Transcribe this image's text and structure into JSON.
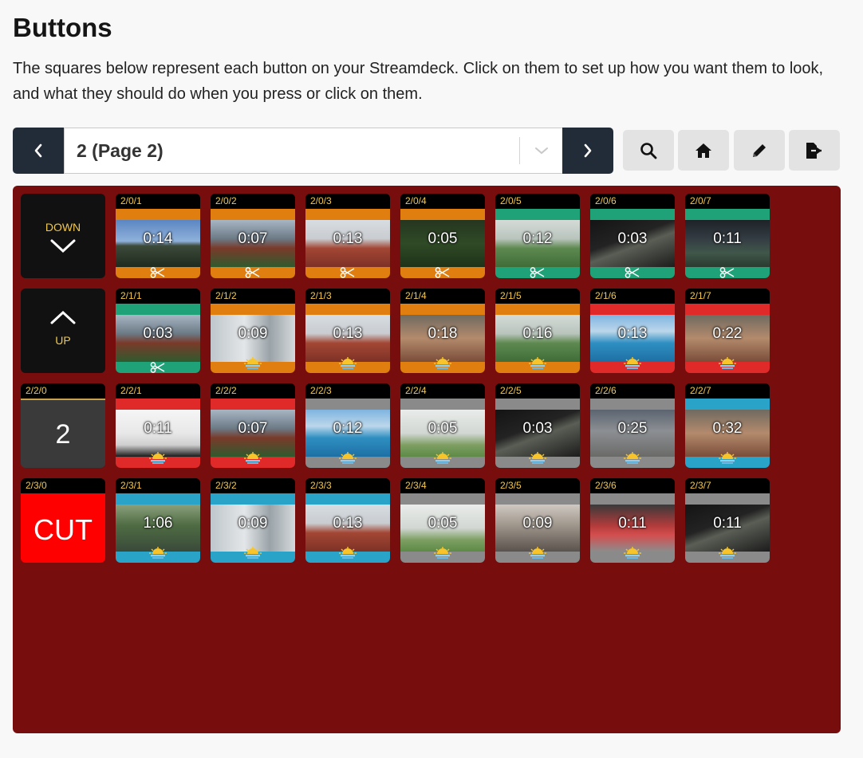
{
  "page": {
    "title": "Buttons",
    "intro": "The squares below represent each button on your Streamdeck. Click on them to set up how you want them to look, and what they should do when you press or click on them."
  },
  "toolbar": {
    "page_select": "2 (Page 2)",
    "prev_icon": "chevron-left-icon",
    "next_icon": "chevron-right-icon",
    "dropdown_icon": "chevron-down-icon",
    "tools": [
      "search-icon",
      "home-icon",
      "pencil-icon",
      "export-icon"
    ]
  },
  "colors": {
    "grid_bg": "#780d0d",
    "label_text": "#f2c94c",
    "nav_dark": "#222b38",
    "orange": "#e07f0f",
    "green": "#1fa277",
    "red": "#e02a2a",
    "gray": "#8a8a8a",
    "blue": "#2aa3c8"
  },
  "grid": {
    "rows": [
      [
        {
          "type": "nav",
          "text": "DOWN",
          "icon": "chevron-down-icon"
        },
        {
          "label": "2/0/1",
          "time": "0:14",
          "color": "orange",
          "icon": "scissors-icon",
          "scene": "city"
        },
        {
          "label": "2/0/2",
          "time": "0:07",
          "color": "orange",
          "icon": "scissors-icon",
          "scene": "stadium"
        },
        {
          "label": "2/0/3",
          "time": "0:13",
          "color": "orange",
          "icon": "scissors-icon",
          "scene": "court"
        },
        {
          "label": "2/0/4",
          "time": "0:05",
          "color": "orange",
          "icon": "scissors-icon",
          "scene": "dark"
        },
        {
          "label": "2/0/5",
          "time": "0:12",
          "color": "green",
          "icon": "scissors-icon",
          "scene": "field"
        },
        {
          "label": "2/0/6",
          "time": "0:03",
          "color": "green",
          "icon": "scissors-icon",
          "scene": "night"
        },
        {
          "label": "2/0/7",
          "time": "0:11",
          "color": "green",
          "icon": "scissors-icon",
          "scene": "pitch"
        }
      ],
      [
        {
          "type": "nav",
          "text": "UP",
          "icon": "chevron-up-icon"
        },
        {
          "label": "2/1/1",
          "time": "0:03",
          "color": "green",
          "icon": "scissors-icon",
          "scene": "stadium"
        },
        {
          "label": "2/1/2",
          "time": "0:09",
          "color": "orange",
          "icon": "sunrise-icon",
          "scene": "people"
        },
        {
          "label": "2/1/3",
          "time": "0:13",
          "color": "orange",
          "icon": "sunrise-icon",
          "scene": "court"
        },
        {
          "label": "2/1/4",
          "time": "0:18",
          "color": "orange",
          "icon": "sunrise-icon",
          "scene": "face"
        },
        {
          "label": "2/1/5",
          "time": "0:16",
          "color": "orange",
          "icon": "sunrise-icon",
          "scene": "field"
        },
        {
          "label": "2/1/6",
          "time": "0:13",
          "color": "red",
          "icon": "sunrise-icon",
          "scene": "pool"
        },
        {
          "label": "2/1/7",
          "time": "0:22",
          "color": "red",
          "icon": "sunrise-icon",
          "scene": "face"
        }
      ],
      [
        {
          "type": "page",
          "label": "2/2/0",
          "text": "2"
        },
        {
          "label": "2/2/1",
          "time": "0:11",
          "color": "red",
          "icon": "sunrise-icon",
          "scene": "hoop"
        },
        {
          "label": "2/2/2",
          "time": "0:07",
          "color": "red",
          "icon": "sunrise-icon",
          "scene": "stadium"
        },
        {
          "label": "2/2/3",
          "time": "0:12",
          "color": "gray",
          "icon": "sunrise-icon",
          "scene": "pool"
        },
        {
          "label": "2/2/4",
          "time": "0:05",
          "color": "gray",
          "icon": "sunrise-icon",
          "scene": "dome"
        },
        {
          "label": "2/2/5",
          "time": "0:03",
          "color": "gray",
          "icon": "sunrise-icon",
          "scene": "night"
        },
        {
          "label": "2/2/6",
          "time": "0:25",
          "color": "gray",
          "icon": "sunrise-icon",
          "scene": "hall"
        },
        {
          "label": "2/2/7",
          "time": "0:32",
          "color": "blue",
          "icon": "sunrise-icon",
          "scene": "face"
        }
      ],
      [
        {
          "type": "cut",
          "label": "2/3/0",
          "text": "CUT"
        },
        {
          "label": "2/3/1",
          "time": "1:06",
          "color": "blue",
          "icon": "sunrise-icon",
          "scene": "trees"
        },
        {
          "label": "2/3/2",
          "time": "0:09",
          "color": "blue",
          "icon": "sunrise-icon",
          "scene": "people"
        },
        {
          "label": "2/3/3",
          "time": "0:13",
          "color": "blue",
          "icon": "sunrise-icon",
          "scene": "court"
        },
        {
          "label": "2/3/4",
          "time": "0:05",
          "color": "gray",
          "icon": "sunrise-icon",
          "scene": "dome"
        },
        {
          "label": "2/3/5",
          "time": "0:09",
          "color": "gray",
          "icon": "sunrise-icon",
          "scene": "track"
        },
        {
          "label": "2/3/6",
          "time": "0:11",
          "color": "gray",
          "icon": "sunrise-icon",
          "scene": "seats"
        },
        {
          "label": "2/3/7",
          "time": "0:11",
          "color": "gray",
          "icon": "sunrise-icon",
          "scene": "night"
        }
      ]
    ]
  }
}
